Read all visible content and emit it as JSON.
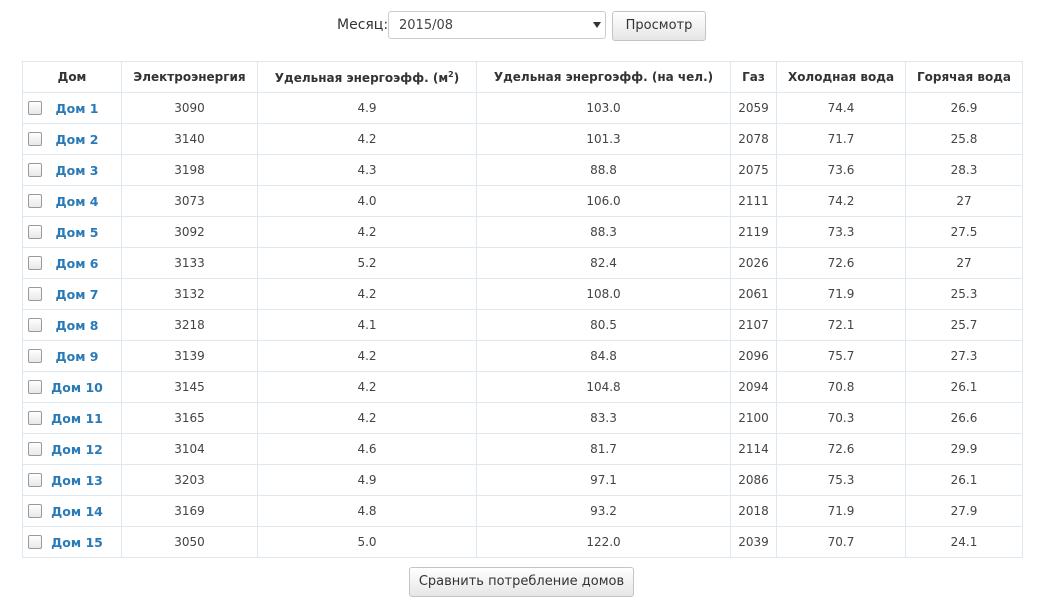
{
  "filter": {
    "month_label": "Месяц:",
    "month_value": "2015/08",
    "view_button": "Просмотр"
  },
  "table": {
    "headers": {
      "house": "Дом",
      "electricity": "Электроэнергия",
      "efficiency_m2_prefix": "Удельная энергоэфф. (м",
      "efficiency_m2_sup": "2",
      "efficiency_m2_suffix": ")",
      "efficiency_person": "Удельная энергоэфф. (на чел.)",
      "gas": "Газ",
      "cold_water": "Холодная вода",
      "hot_water": "Горячая вода"
    },
    "rows": [
      {
        "house": "Дом 1",
        "electricity": "3090",
        "eff_m2": "4.9",
        "eff_person": "103.0",
        "gas": "2059",
        "cold": "74.4",
        "hot": "26.9"
      },
      {
        "house": "Дом 2",
        "electricity": "3140",
        "eff_m2": "4.2",
        "eff_person": "101.3",
        "gas": "2078",
        "cold": "71.7",
        "hot": "25.8"
      },
      {
        "house": "Дом 3",
        "electricity": "3198",
        "eff_m2": "4.3",
        "eff_person": "88.8",
        "gas": "2075",
        "cold": "73.6",
        "hot": "28.3"
      },
      {
        "house": "Дом 4",
        "electricity": "3073",
        "eff_m2": "4.0",
        "eff_person": "106.0",
        "gas": "2111",
        "cold": "74.2",
        "hot": "27"
      },
      {
        "house": "Дом 5",
        "electricity": "3092",
        "eff_m2": "4.2",
        "eff_person": "88.3",
        "gas": "2119",
        "cold": "73.3",
        "hot": "27.5"
      },
      {
        "house": "Дом 6",
        "electricity": "3133",
        "eff_m2": "5.2",
        "eff_person": "82.4",
        "gas": "2026",
        "cold": "72.6",
        "hot": "27"
      },
      {
        "house": "Дом 7",
        "electricity": "3132",
        "eff_m2": "4.2",
        "eff_person": "108.0",
        "gas": "2061",
        "cold": "71.9",
        "hot": "25.3"
      },
      {
        "house": "Дом 8",
        "electricity": "3218",
        "eff_m2": "4.1",
        "eff_person": "80.5",
        "gas": "2107",
        "cold": "72.1",
        "hot": "25.7"
      },
      {
        "house": "Дом 9",
        "electricity": "3139",
        "eff_m2": "4.2",
        "eff_person": "84.8",
        "gas": "2096",
        "cold": "75.7",
        "hot": "27.3"
      },
      {
        "house": "Дом 10",
        "electricity": "3145",
        "eff_m2": "4.2",
        "eff_person": "104.8",
        "gas": "2094",
        "cold": "70.8",
        "hot": "26.1"
      },
      {
        "house": "Дом 11",
        "electricity": "3165",
        "eff_m2": "4.2",
        "eff_person": "83.3",
        "gas": "2100",
        "cold": "70.3",
        "hot": "26.6"
      },
      {
        "house": "Дом 12",
        "electricity": "3104",
        "eff_m2": "4.6",
        "eff_person": "81.7",
        "gas": "2114",
        "cold": "72.6",
        "hot": "29.9"
      },
      {
        "house": "Дом 13",
        "electricity": "3203",
        "eff_m2": "4.9",
        "eff_person": "97.1",
        "gas": "2086",
        "cold": "75.3",
        "hot": "26.1"
      },
      {
        "house": "Дом 14",
        "electricity": "3169",
        "eff_m2": "4.8",
        "eff_person": "93.2",
        "gas": "2018",
        "cold": "71.9",
        "hot": "27.9"
      },
      {
        "house": "Дом 15",
        "electricity": "3050",
        "eff_m2": "5.0",
        "eff_person": "122.0",
        "gas": "2039",
        "cold": "70.7",
        "hot": "24.1"
      }
    ]
  },
  "footer": {
    "compare_button": "Сравнить потребление домов"
  },
  "colors": {
    "link": "#2a7ab8",
    "border": "#dde8f0"
  }
}
